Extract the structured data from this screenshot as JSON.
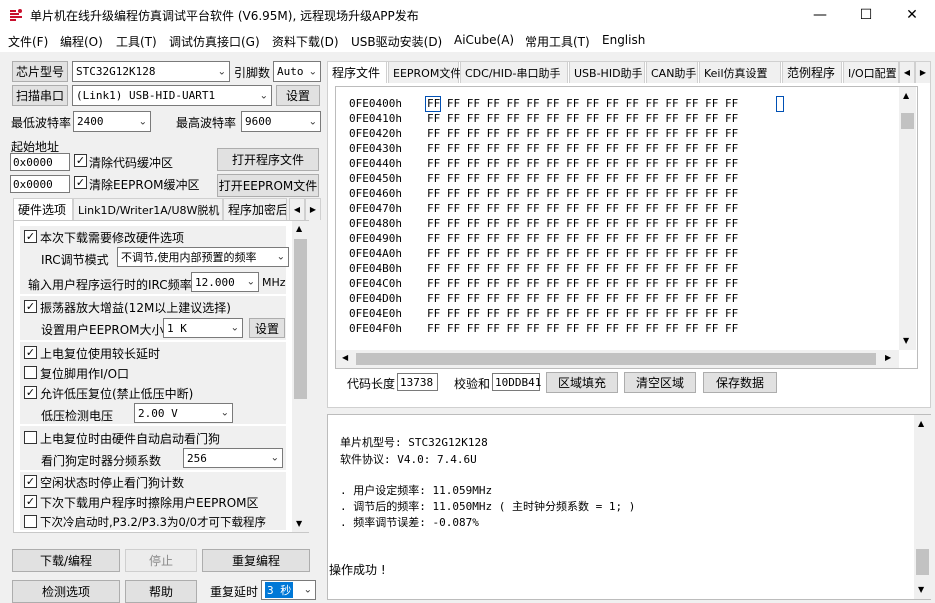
{
  "window": {
    "title": "单片机在线升级编程仿真调试平台软件 (V6.95M), 远程现场升级APP发布",
    "minimize": "—",
    "maximize": "☐",
    "close": "✕"
  },
  "menu": [
    "文件(F)",
    "编程(O)",
    "工具(T)",
    "调试仿真接口(G)",
    "资料下载(D)",
    "USB驱动安装(D)",
    "AiCube(A)",
    "常用工具(T)",
    "English"
  ],
  "left": {
    "chip_label": "芯片型号",
    "chip_value": "STC32G12K128",
    "pins_label": "引脚数",
    "pins_value": "Auto",
    "scan_button": "扫描串口",
    "port_value": "(Link1) USB-HID-UART1",
    "settings_button": "设置",
    "min_baud_label": "最低波特率",
    "min_baud_value": "2400",
    "max_baud_label": "最高波特率",
    "max_baud_value": "9600",
    "start_addr_label": "起始地址",
    "code_addr": "0x0000",
    "clear_code_label": "清除代码缓冲区",
    "open_program_button": "打开程序文件",
    "eeprom_addr": "0x0000",
    "clear_eeprom_label": "清除EEPROM缓冲区",
    "open_eeprom_button": "打开EEPROM文件",
    "tabs": [
      "硬件选项",
      "Link1D/Writer1A/U8W脱机",
      "程序加密后"
    ],
    "options": {
      "modify_hw": "本次下载需要修改硬件选项",
      "irc_mode_label": "IRC调节模式",
      "irc_mode_value": "不调节,使用内部预置的频率",
      "irc_freq_label": "输入用户程序运行时的IRC频率",
      "irc_freq_value": "12.000",
      "irc_freq_unit": "MHz",
      "osc_gain": "振荡器放大增益(12M以上建议选择)",
      "eeprom_size_label": "设置用户EEPROM大小",
      "eeprom_size_value": "1   K",
      "eeprom_set_button": "设置",
      "long_reset": "上电复位使用较长延时",
      "reset_io": "复位脚用作I/O口",
      "lvd_reset": "允许低压复位(禁止低压中断)",
      "lvd_label": "低压检测电压",
      "lvd_value": "2.00 V",
      "auto_wdt": "上电复位时由硬件自动启动看门狗",
      "wdt_div_label": "看门狗定时器分频系数",
      "wdt_div_value": "256",
      "idle_wdt": "空闲状态时停止看门狗计数",
      "erase_eeprom": "下次下载用户程序时擦除用户EEPROM区",
      "cold_boot": "下次冷启动时,P3.2/P3.3为0/0才可下载程序"
    },
    "download_button": "下载/编程",
    "stop_button": "停止",
    "reprogram_button": "重复编程",
    "check_button": "检测选项",
    "help_button": "帮助",
    "repeat_delay_label": "重复延时",
    "repeat_delay_value": "3 秒"
  },
  "right": {
    "tabs": [
      "程序文件",
      "EEPROM文件",
      "CDC/HID-串口助手",
      "USB-HID助手",
      "CAN助手",
      "Keil仿真设置",
      "范例程序",
      "I/O口配置"
    ],
    "hex_rows": [
      {
        "addr": "0FE0400h",
        "bytes": "FF FF FF FF FF FF FF FF FF FF FF FF FF FF FF FF"
      },
      {
        "addr": "0FE0410h",
        "bytes": "FF FF FF FF FF FF FF FF FF FF FF FF FF FF FF FF"
      },
      {
        "addr": "0FE0420h",
        "bytes": "FF FF FF FF FF FF FF FF FF FF FF FF FF FF FF FF"
      },
      {
        "addr": "0FE0430h",
        "bytes": "FF FF FF FF FF FF FF FF FF FF FF FF FF FF FF FF"
      },
      {
        "addr": "0FE0440h",
        "bytes": "FF FF FF FF FF FF FF FF FF FF FF FF FF FF FF FF"
      },
      {
        "addr": "0FE0450h",
        "bytes": "FF FF FF FF FF FF FF FF FF FF FF FF FF FF FF FF"
      },
      {
        "addr": "0FE0460h",
        "bytes": "FF FF FF FF FF FF FF FF FF FF FF FF FF FF FF FF"
      },
      {
        "addr": "0FE0470h",
        "bytes": "FF FF FF FF FF FF FF FF FF FF FF FF FF FF FF FF"
      },
      {
        "addr": "0FE0480h",
        "bytes": "FF FF FF FF FF FF FF FF FF FF FF FF FF FF FF FF"
      },
      {
        "addr": "0FE0490h",
        "bytes": "FF FF FF FF FF FF FF FF FF FF FF FF FF FF FF FF"
      },
      {
        "addr": "0FE04A0h",
        "bytes": "FF FF FF FF FF FF FF FF FF FF FF FF FF FF FF FF"
      },
      {
        "addr": "0FE04B0h",
        "bytes": "FF FF FF FF FF FF FF FF FF FF FF FF FF FF FF FF"
      },
      {
        "addr": "0FE04C0h",
        "bytes": "FF FF FF FF FF FF FF FF FF FF FF FF FF FF FF FF"
      },
      {
        "addr": "0FE04D0h",
        "bytes": "FF FF FF FF FF FF FF FF FF FF FF FF FF FF FF FF"
      },
      {
        "addr": "0FE04E0h",
        "bytes": "FF FF FF FF FF FF FF FF FF FF FF FF FF FF FF FF"
      },
      {
        "addr": "0FE04F0h",
        "bytes": "FF FF FF FF FF FF FF FF FF FF FF FF FF FF FF FF"
      }
    ],
    "code_len_label": "代码长度",
    "code_len_value": "13738",
    "checksum_label": "校验和",
    "checksum_value": "10DDB41",
    "fill_button": "区域填充",
    "clear_button": "清空区域",
    "save_button": "保存数据",
    "log": [
      "单片机型号: STC32G12K128",
      "软件协议: V4.0: 7.4.6U",
      "",
      ". 用户设定频率: 11.059MHz",
      ". 调节后的频率: 11.050MHz ( 主时钟分频系数 = 1; )",
      ". 频率调节误差: -0.087%"
    ],
    "status": "操作成功 !"
  },
  "colors": {
    "check_blue": "#0050b4",
    "selection": "#0078d7"
  }
}
